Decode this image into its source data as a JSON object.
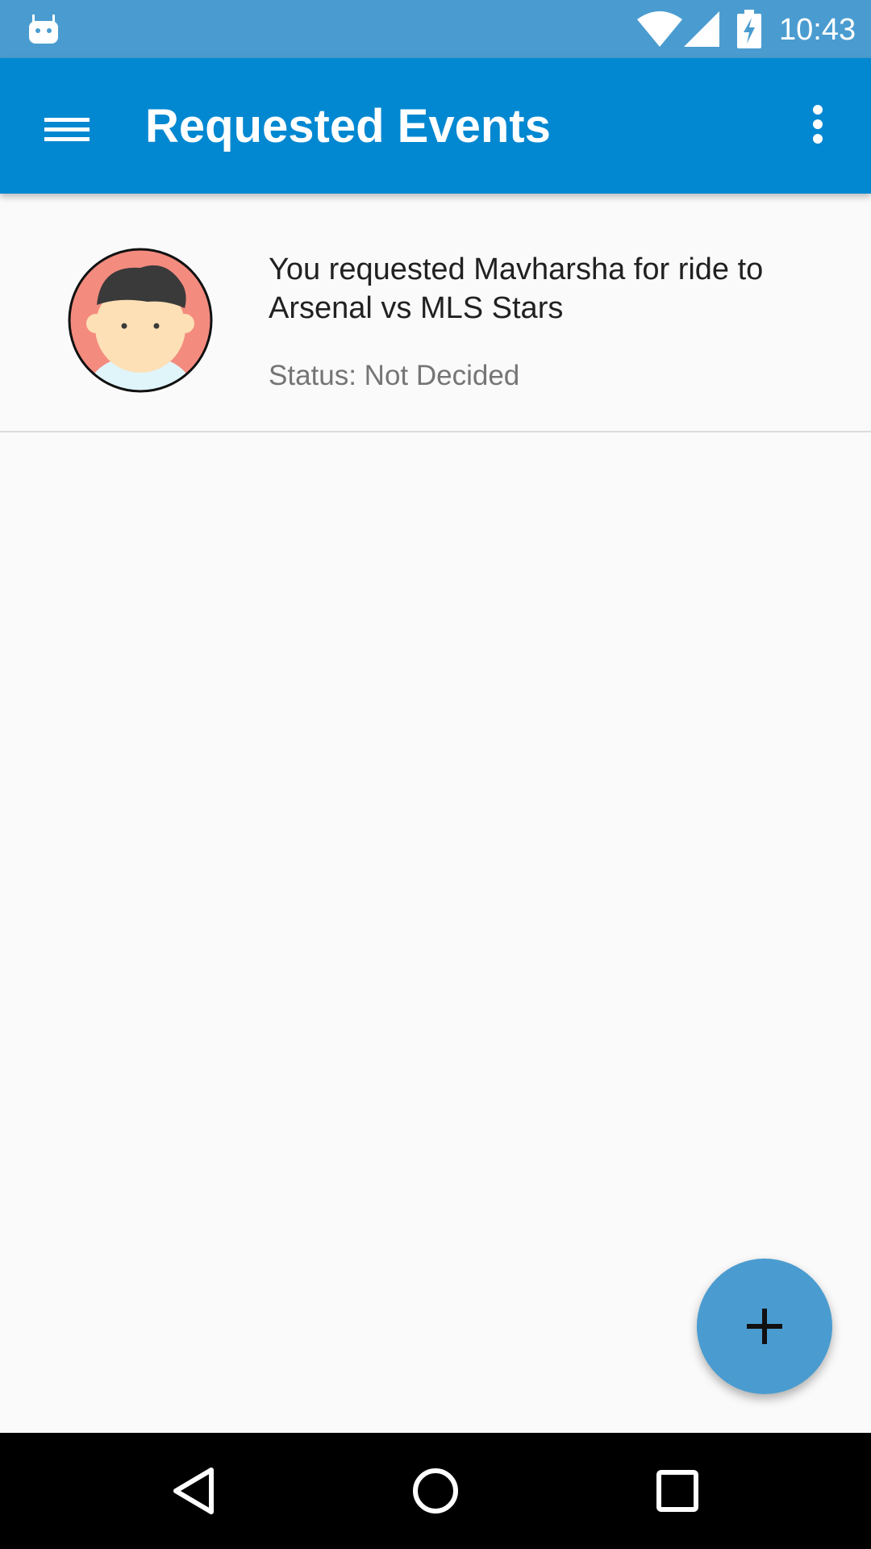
{
  "status_bar": {
    "time": "10:43",
    "icons": [
      "android-notification-icon",
      "wifi-icon",
      "signal-icon",
      "battery-charging-icon"
    ]
  },
  "app_bar": {
    "title": "Requested Events",
    "menu_icon": "hamburger-menu-icon",
    "overflow_icon": "more-vert-icon",
    "background_color": "#0288d1"
  },
  "requests": [
    {
      "title": "You requested Mavharsha for ride to Arsenal vs MLS Stars",
      "status": "Status: Not Decided",
      "avatar_icon": "user-avatar-icon"
    }
  ],
  "fab": {
    "icon": "add-icon",
    "color": "#4a9cd0"
  },
  "nav_bar": {
    "icons": [
      "back-icon",
      "home-icon",
      "recents-icon"
    ]
  }
}
